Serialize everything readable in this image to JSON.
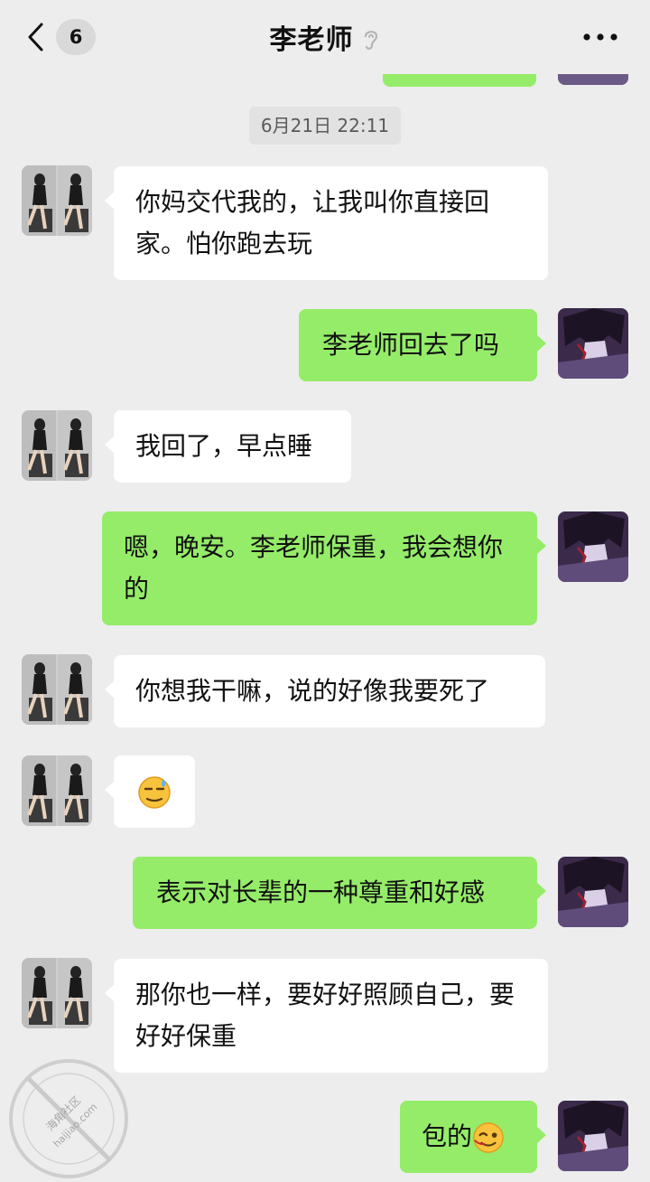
{
  "header": {
    "unread_count": "6",
    "title": "李老师",
    "back_icon": "chevron-left-icon",
    "mute_icon": "ear-icon",
    "more_icon": "more-dots-icon"
  },
  "timestamp": "6月21日 22:11",
  "messages": [
    {
      "side": "in",
      "text": "你妈交代我的，让我叫你直接回家。怕你跑去玩"
    },
    {
      "side": "out",
      "text": "李老师回去了吗"
    },
    {
      "side": "in",
      "text": "我回了，早点睡"
    },
    {
      "side": "out",
      "text": "嗯，晚安。李老师保重，我会想你的"
    },
    {
      "side": "in",
      "text": "你想我干嘛，说的好像我要死了"
    },
    {
      "side": "in",
      "text": "",
      "emoji": "sweat-smile-emoji"
    },
    {
      "side": "out",
      "text": "表示对长辈的一种尊重和好感"
    },
    {
      "side": "in",
      "text": "那你也一样，要好好照顾自己，要好好保重"
    },
    {
      "side": "out",
      "text": "包的",
      "emoji": "wink-emoji"
    }
  ],
  "colors": {
    "background": "#ededed",
    "outgoing_bubble": "#95ec69",
    "incoming_bubble": "#ffffff"
  },
  "watermark": {
    "site": "海角社区",
    "url": "haijiao.com"
  }
}
